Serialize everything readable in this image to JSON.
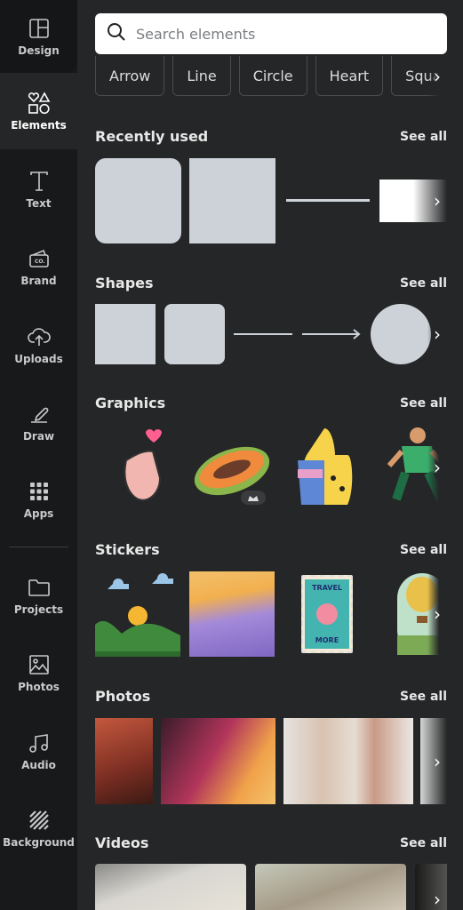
{
  "sidebar": {
    "items": [
      {
        "label": "Design",
        "icon": "layout-icon"
      },
      {
        "label": "Elements",
        "icon": "shapes-icon",
        "active": true
      },
      {
        "label": "Text",
        "icon": "text-icon"
      },
      {
        "label": "Brand",
        "icon": "brand-icon"
      },
      {
        "label": "Uploads",
        "icon": "cloud-upload-icon"
      },
      {
        "label": "Draw",
        "icon": "pen-icon"
      },
      {
        "label": "Apps",
        "icon": "grid-icon"
      },
      {
        "label": "Projects",
        "icon": "folder-icon"
      },
      {
        "label": "Photos",
        "icon": "image-icon"
      },
      {
        "label": "Audio",
        "icon": "music-icon"
      },
      {
        "label": "Background",
        "icon": "stripes-icon"
      }
    ]
  },
  "search": {
    "placeholder": "Search elements"
  },
  "chips": [
    "Arrow",
    "Line",
    "Circle",
    "Heart",
    "Square"
  ],
  "sections": {
    "recent": {
      "title": "Recently used",
      "see_all": "See all"
    },
    "shapes": {
      "title": "Shapes",
      "see_all": "See all"
    },
    "graphics": {
      "title": "Graphics",
      "see_all": "See all"
    },
    "stickers": {
      "title": "Stickers",
      "see_all": "See all",
      "travel_line1": "TRAVEL",
      "travel_line2": "MORE"
    },
    "photos": {
      "title": "Photos",
      "see_all": "See all"
    },
    "videos": {
      "title": "Videos",
      "see_all": "See all"
    }
  },
  "colors": {
    "sidebar": "#18191b",
    "panel": "#252627",
    "shape": "#cdd2d8"
  }
}
